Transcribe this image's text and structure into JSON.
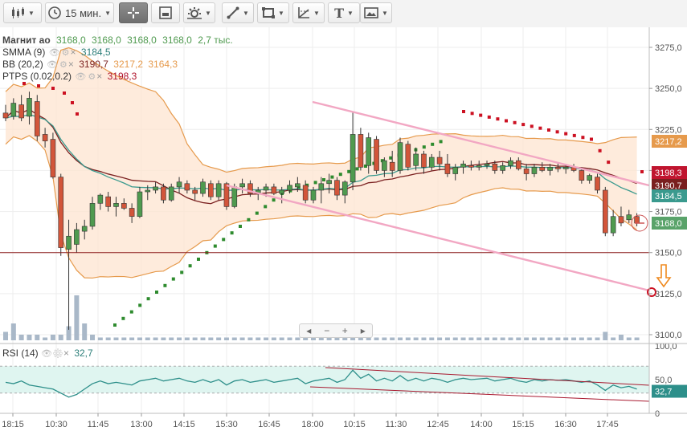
{
  "toolbar": {
    "timeframe": "15 мин."
  },
  "legend": {
    "symbol": "Магнит ао",
    "ohlc": [
      "3168,0",
      "3168,0",
      "3168,0",
      "3168,0"
    ],
    "volume": "2,7 тыс.",
    "smma_name": "SMMA (9)",
    "smma_value": "3184,5",
    "bb_name": "BB (20,2)",
    "bb_values": [
      "3190,7",
      "3217,2",
      "3164,3"
    ],
    "ptps_name": "PTPS (0.02,0.2)",
    "ptps_value": "3198,3"
  },
  "price_axis": {
    "ticks": [
      "3275,0",
      "3250,0",
      "3225,0",
      "3200,0",
      "3175,0",
      "3150,0",
      "3125,0",
      "3100,0"
    ]
  },
  "price_tags": [
    {
      "text": "3217,2",
      "color": "#e69a4c"
    },
    {
      "text": "3198,3",
      "color": "#c0152f"
    },
    {
      "text": "3190,7",
      "color": "#7a1f1f"
    },
    {
      "text": "3184,5",
      "color": "#3a9a8e"
    },
    {
      "text": "3168,0",
      "color": "#5aa36a"
    }
  ],
  "rsi": {
    "name": "RSI (14)",
    "value": "32,7",
    "ticks": [
      "100,0",
      "50,0",
      "0"
    ]
  },
  "time_axis": {
    "labels": [
      "18:15",
      "10:30",
      "11:45",
      "13:00",
      "14:15",
      "15:30",
      "16:45",
      "18:00",
      "10:15",
      "11:30",
      "12:45",
      "14:00",
      "15:15",
      "16:30",
      "17:45"
    ]
  },
  "scroll_control": {
    "left": "◂",
    "minus": "−",
    "plus": "+",
    "right": "▸"
  },
  "colors": {
    "up_candle": "#4f9a4f",
    "down_candle": "#d2553a",
    "bb_fill": "#fde4d0",
    "bb_band": "#e69a4c",
    "bb_mid": "#7a1f1f",
    "smma": "#3a9a8e",
    "ptps_up": "#2e8b2e",
    "ptps_down": "#cc1122",
    "trendline": "#f2a7c3",
    "rsi_line": "#2d8f8a",
    "rsi_fill": "#dff5f0"
  },
  "chart_data": {
    "type": "candlestick",
    "symbol": "Магнит ао",
    "interval": "15 мин.",
    "ylim": [
      3100,
      3280
    ],
    "candles": [
      {
        "o": 3235,
        "h": 3240,
        "l": 3230,
        "c": 3232
      },
      {
        "o": 3233,
        "h": 3244,
        "l": 3231,
        "c": 3241
      },
      {
        "o": 3240,
        "h": 3246,
        "l": 3230,
        "c": 3232
      },
      {
        "o": 3233,
        "h": 3248,
        "l": 3228,
        "c": 3244
      },
      {
        "o": 3242,
        "h": 3246,
        "l": 3218,
        "c": 3221
      },
      {
        "o": 3222,
        "h": 3226,
        "l": 3214,
        "c": 3218
      },
      {
        "o": 3219,
        "h": 3223,
        "l": 3195,
        "c": 3196
      },
      {
        "o": 3196,
        "h": 3198,
        "l": 3148,
        "c": 3153
      },
      {
        "o": 3152,
        "h": 3170,
        "l": 3103,
        "c": 3160
      },
      {
        "o": 3155,
        "h": 3168,
        "l": 3150,
        "c": 3164
      },
      {
        "o": 3163,
        "h": 3170,
        "l": 3158,
        "c": 3166
      },
      {
        "o": 3166,
        "h": 3184,
        "l": 3164,
        "c": 3180
      },
      {
        "o": 3180,
        "h": 3186,
        "l": 3176,
        "c": 3185
      },
      {
        "o": 3184,
        "h": 3187,
        "l": 3175,
        "c": 3178
      },
      {
        "o": 3178,
        "h": 3184,
        "l": 3172,
        "c": 3180
      },
      {
        "o": 3180,
        "h": 3183,
        "l": 3176,
        "c": 3177
      },
      {
        "o": 3177,
        "h": 3180,
        "l": 3168,
        "c": 3172
      },
      {
        "o": 3172,
        "h": 3190,
        "l": 3171,
        "c": 3187
      },
      {
        "o": 3187,
        "h": 3191,
        "l": 3182,
        "c": 3188
      },
      {
        "o": 3188,
        "h": 3193,
        "l": 3186,
        "c": 3190
      },
      {
        "o": 3190,
        "h": 3192,
        "l": 3180,
        "c": 3182
      },
      {
        "o": 3182,
        "h": 3192,
        "l": 3181,
        "c": 3190
      },
      {
        "o": 3190,
        "h": 3196,
        "l": 3186,
        "c": 3193
      },
      {
        "o": 3192,
        "h": 3194,
        "l": 3186,
        "c": 3188
      },
      {
        "o": 3188,
        "h": 3190,
        "l": 3182,
        "c": 3186
      },
      {
        "o": 3186,
        "h": 3195,
        "l": 3184,
        "c": 3193
      },
      {
        "o": 3192,
        "h": 3194,
        "l": 3182,
        "c": 3184
      },
      {
        "o": 3184,
        "h": 3194,
        "l": 3182,
        "c": 3192
      },
      {
        "o": 3192,
        "h": 3193,
        "l": 3176,
        "c": 3178
      },
      {
        "o": 3178,
        "h": 3192,
        "l": 3177,
        "c": 3190
      },
      {
        "o": 3190,
        "h": 3195,
        "l": 3186,
        "c": 3192
      },
      {
        "o": 3192,
        "h": 3194,
        "l": 3184,
        "c": 3186
      },
      {
        "o": 3186,
        "h": 3190,
        "l": 3182,
        "c": 3188
      },
      {
        "o": 3188,
        "h": 3192,
        "l": 3184,
        "c": 3190
      },
      {
        "o": 3190,
        "h": 3192,
        "l": 3185,
        "c": 3186
      },
      {
        "o": 3186,
        "h": 3190,
        "l": 3180,
        "c": 3188
      },
      {
        "o": 3188,
        "h": 3194,
        "l": 3186,
        "c": 3191
      },
      {
        "o": 3190,
        "h": 3196,
        "l": 3187,
        "c": 3192
      },
      {
        "o": 3191,
        "h": 3194,
        "l": 3180,
        "c": 3182
      },
      {
        "o": 3182,
        "h": 3190,
        "l": 3180,
        "c": 3188
      },
      {
        "o": 3188,
        "h": 3196,
        "l": 3180,
        "c": 3192
      },
      {
        "o": 3192,
        "h": 3198,
        "l": 3186,
        "c": 3194
      },
      {
        "o": 3194,
        "h": 3196,
        "l": 3182,
        "c": 3185
      },
      {
        "o": 3185,
        "h": 3194,
        "l": 3180,
        "c": 3193
      },
      {
        "o": 3193,
        "h": 3236,
        "l": 3188,
        "c": 3222
      },
      {
        "o": 3222,
        "h": 3226,
        "l": 3200,
        "c": 3202
      },
      {
        "o": 3203,
        "h": 3223,
        "l": 3198,
        "c": 3220
      },
      {
        "o": 3219,
        "h": 3221,
        "l": 3198,
        "c": 3200
      },
      {
        "o": 3200,
        "h": 3208,
        "l": 3196,
        "c": 3206
      },
      {
        "o": 3205,
        "h": 3212,
        "l": 3196,
        "c": 3200
      },
      {
        "o": 3200,
        "h": 3220,
        "l": 3198,
        "c": 3217
      },
      {
        "o": 3216,
        "h": 3218,
        "l": 3200,
        "c": 3202
      },
      {
        "o": 3203,
        "h": 3214,
        "l": 3200,
        "c": 3210
      },
      {
        "o": 3210,
        "h": 3212,
        "l": 3198,
        "c": 3202
      },
      {
        "o": 3202,
        "h": 3210,
        "l": 3200,
        "c": 3208
      },
      {
        "o": 3208,
        "h": 3212,
        "l": 3200,
        "c": 3204
      },
      {
        "o": 3204,
        "h": 3210,
        "l": 3196,
        "c": 3198
      },
      {
        "o": 3198,
        "h": 3204,
        "l": 3194,
        "c": 3202
      },
      {
        "o": 3202,
        "h": 3206,
        "l": 3198,
        "c": 3204
      },
      {
        "o": 3203,
        "h": 3206,
        "l": 3200,
        "c": 3202
      },
      {
        "o": 3202,
        "h": 3206,
        "l": 3200,
        "c": 3203
      },
      {
        "o": 3203,
        "h": 3206,
        "l": 3201,
        "c": 3204
      },
      {
        "o": 3204,
        "h": 3206,
        "l": 3198,
        "c": 3200
      },
      {
        "o": 3200,
        "h": 3205,
        "l": 3198,
        "c": 3203
      },
      {
        "o": 3203,
        "h": 3208,
        "l": 3201,
        "c": 3206
      },
      {
        "o": 3206,
        "h": 3208,
        "l": 3200,
        "c": 3201
      },
      {
        "o": 3201,
        "h": 3204,
        "l": 3194,
        "c": 3198
      },
      {
        "o": 3198,
        "h": 3204,
        "l": 3196,
        "c": 3202
      },
      {
        "o": 3202,
        "h": 3205,
        "l": 3199,
        "c": 3200
      },
      {
        "o": 3200,
        "h": 3204,
        "l": 3197,
        "c": 3202
      },
      {
        "o": 3202,
        "h": 3205,
        "l": 3199,
        "c": 3201
      },
      {
        "o": 3201,
        "h": 3204,
        "l": 3198,
        "c": 3202
      },
      {
        "o": 3202,
        "h": 3204,
        "l": 3199,
        "c": 3200
      },
      {
        "o": 3200,
        "h": 3202,
        "l": 3192,
        "c": 3194
      },
      {
        "o": 3194,
        "h": 3198,
        "l": 3192,
        "c": 3197
      },
      {
        "o": 3196,
        "h": 3198,
        "l": 3186,
        "c": 3188
      },
      {
        "o": 3188,
        "h": 3190,
        "l": 3160,
        "c": 3162
      },
      {
        "o": 3162,
        "h": 3176,
        "l": 3160,
        "c": 3172
      },
      {
        "o": 3172,
        "h": 3178,
        "l": 3166,
        "c": 3168
      },
      {
        "o": 3170,
        "h": 3176,
        "l": 3168,
        "c": 3173
      },
      {
        "o": 3172,
        "h": 3174,
        "l": 3166,
        "c": 3168
      }
    ],
    "last_price": 3168.0,
    "horizontal_line": 3150,
    "rsi_last": 32.7,
    "rsi_ylim": [
      0,
      100
    ]
  }
}
